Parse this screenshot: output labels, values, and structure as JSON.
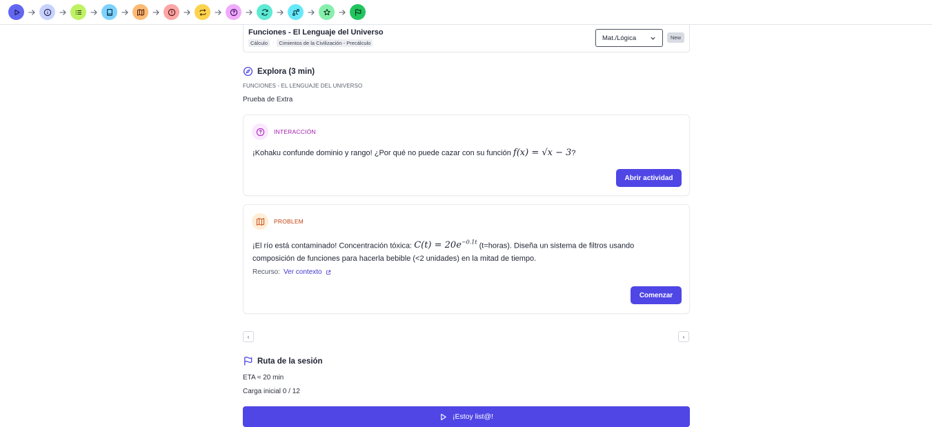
{
  "steps": [
    {
      "icon": "play-icon",
      "color": "#6366f1",
      "stroke": "#1e1b4b"
    },
    {
      "icon": "info-icon",
      "color": "#c7d2fe",
      "stroke": "#1e1b4b"
    },
    {
      "icon": "list-icon",
      "color": "#bef264",
      "stroke": "#1a2e05"
    },
    {
      "icon": "book-icon",
      "color": "#7dd3fc",
      "stroke": "#082f49"
    },
    {
      "icon": "map-icon",
      "color": "#fdba74",
      "stroke": "#431407"
    },
    {
      "icon": "alert-icon",
      "color": "#fca5a5",
      "stroke": "#450a0a"
    },
    {
      "icon": "repeat-icon",
      "color": "#fcd34d",
      "stroke": "#422006"
    },
    {
      "icon": "question-icon",
      "color": "#f0abfc",
      "stroke": "#3b0764"
    },
    {
      "icon": "refresh-icon",
      "color": "#5eead4",
      "stroke": "#042f2e"
    },
    {
      "icon": "route-icon",
      "color": "#67e8f9",
      "stroke": "#083344"
    },
    {
      "icon": "star-icon",
      "color": "#86efac",
      "stroke": "#052e16"
    },
    {
      "icon": "flag-icon",
      "color": "#22c55e",
      "stroke": "#052e16"
    }
  ],
  "lesson": {
    "title": "Funciones - El Lenguaje del Universo",
    "tag1": "Cálculo",
    "separator": "·",
    "tag2": "Cimientos de la Civilización - Precálculo",
    "select_value": "Mat./Lógica",
    "badge": "New"
  },
  "explore": {
    "title": "Explora (3 min)",
    "subtitle": "FUNCIONES - EL LENGUAJE DEL UNIVERSO",
    "note": "Prueba de Extra"
  },
  "interaction_card": {
    "label": "INTERACCIÓN",
    "text_before": "¡Kohaku confunde dominio y rango! ¿Por qué no puede cazar con su función ",
    "math": "f(x) = √x − 3",
    "text_after": "?",
    "button": "Abrir actividad",
    "accent": "#a21caf"
  },
  "problem_card": {
    "label": "PROBLEM",
    "text_before": "¡El río está contaminado! Concentración tóxica: ",
    "math_base": "C(t) = 20e",
    "math_exp": "−0.1t",
    "text_after": " (t=horas). Diseña un sistema de filtros usando",
    "text_line2": "composición de funciones para hacerla bebible (<2 unidades) en la mitad de tiempo.",
    "resource_label": "Recurso:",
    "resource_link": "Ver contexto",
    "button": "Comenzar",
    "accent": "#c2410c"
  },
  "pager": {
    "prev": "‹",
    "next": "›"
  },
  "session": {
    "title": "Ruta de la sesión",
    "eta": "ETA ≈ 20 min",
    "load": "Carga inicial 0 / 12"
  },
  "cta": {
    "label": "¡Estoy list@!"
  }
}
